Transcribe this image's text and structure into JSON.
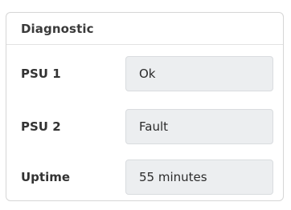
{
  "panel": {
    "title": "Diagnostic",
    "rows": [
      {
        "label": "PSU 1",
        "value": "Ok"
      },
      {
        "label": "PSU 2",
        "value": "Fault"
      },
      {
        "label": "Uptime",
        "value": "55 minutes"
      }
    ]
  }
}
